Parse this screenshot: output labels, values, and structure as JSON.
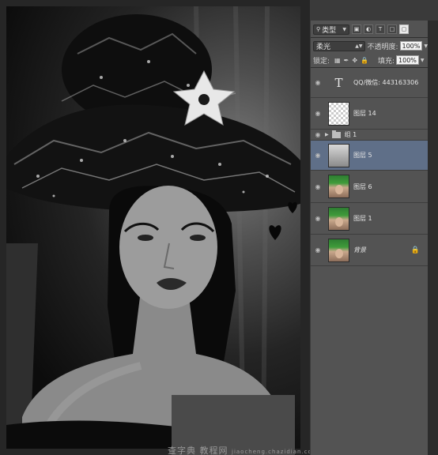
{
  "layers_panel": {
    "filter_kind": "类型",
    "filter_icons": [
      "image-filter-icon",
      "adjustment-filter-icon",
      "type-filter-icon",
      "shape-filter-icon",
      "smart-filter-icon"
    ],
    "blend_mode": "柔光",
    "opacity_label": "不透明度:",
    "opacity_value": "100%",
    "lock_label": "锁定:",
    "fill_label": "填充:",
    "fill_value": "100%",
    "layers": [
      {
        "name": "QQ/微信: 443163306",
        "kind": "text",
        "visible": true,
        "selected": false
      },
      {
        "name": "图层 14",
        "kind": "pixel",
        "thumbnail": "transparent",
        "visible": true,
        "selected": false
      },
      {
        "name": "组 1",
        "kind": "group",
        "collapsed": true,
        "visible": true,
        "selected": false
      },
      {
        "name": "图层 5",
        "kind": "pixel",
        "thumbnail": "bw",
        "visible": true,
        "selected": true
      },
      {
        "name": "图层 6",
        "kind": "pixel",
        "thumbnail": "color",
        "visible": true,
        "selected": false
      },
      {
        "name": "图层 1",
        "kind": "pixel",
        "thumbnail": "color",
        "visible": true,
        "selected": false
      },
      {
        "name": "背景",
        "kind": "background",
        "thumbnail": "color",
        "visible": true,
        "locked": true,
        "selected": false
      }
    ]
  },
  "watermark": {
    "site": "查字典",
    "sub": "教程网",
    "url": "jiaocheng.chazidian.com"
  },
  "canvas": {
    "overlay_text": "QQ/微信: 443163306"
  },
  "colors": {
    "selection": "#5f6f88",
    "panel": "#535353",
    "hat_accent": "#e8e8e8"
  }
}
